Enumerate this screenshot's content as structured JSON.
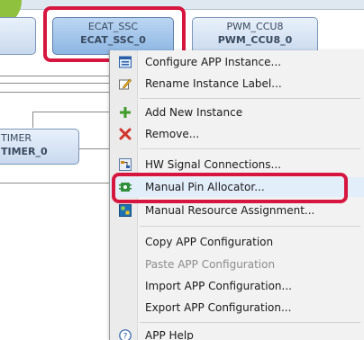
{
  "blocks": {
    "ecat": {
      "line1": "ECAT_SSC",
      "line2": "ECAT_SSC_0"
    },
    "pwm": {
      "line1": "PWM_CCU8",
      "line2": "PWM_CCU8_0"
    },
    "timer": {
      "line1": "TIMER",
      "line2": "TIMER_0"
    }
  },
  "menu": {
    "items": [
      {
        "label": "Configure APP Instance...",
        "icon": "configure-icon"
      },
      {
        "label": "Rename Instance Label...",
        "icon": "rename-icon"
      },
      {
        "label": "Add New Instance",
        "icon": "add-icon"
      },
      {
        "label": "Remove...",
        "icon": "remove-icon"
      },
      {
        "label": "HW Signal Connections...",
        "icon": "signal-connections-icon"
      },
      {
        "label": "Manual Pin Allocator...",
        "icon": "pin-allocator-icon"
      },
      {
        "label": "Manual Resource Assignment...",
        "icon": "resource-assignment-icon"
      },
      {
        "label": "Copy APP Configuration"
      },
      {
        "label": "Paste APP Configuration",
        "disabled": true
      },
      {
        "label": "Import APP Configuration..."
      },
      {
        "label": "Export APP Configuration..."
      },
      {
        "label": "APP Help",
        "icon": "help-icon"
      }
    ]
  },
  "colors": {
    "highlight": "#d6163f",
    "accent_green": "#8fc13e"
  }
}
